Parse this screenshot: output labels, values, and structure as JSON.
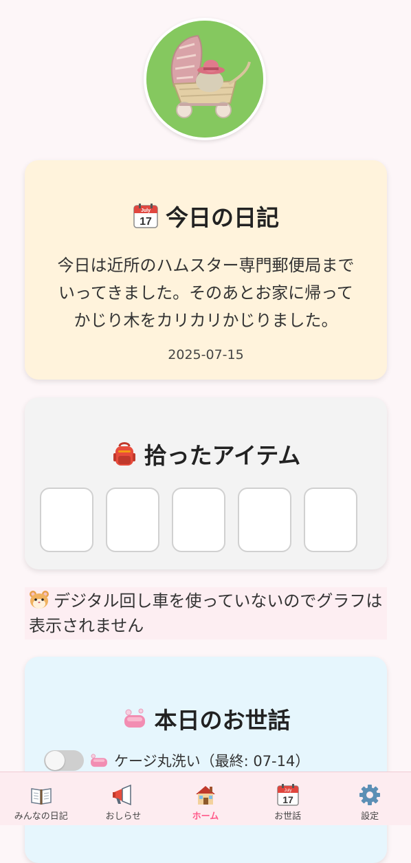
{
  "diary": {
    "title": "今日の日記",
    "icon": "calendar-icon",
    "calendar_month": "July",
    "calendar_day": "17",
    "line1": "今日は近所のハムスター専門郵便局まで",
    "line2": "いってきました。そのあとお家に帰って",
    "line3": "かじり木をカリカリかじりました。",
    "date": "2025-07-15"
  },
  "items": {
    "title": "拾ったアイテム",
    "icon": "backpack-icon",
    "slot_count": 5
  },
  "notice": {
    "icon": "hamster-icon",
    "text": "デジタル回し車を使っていないのでグラフは表示されません"
  },
  "care": {
    "title": "本日のお世話",
    "icon": "soap-icon",
    "tasks": [
      {
        "label": "ケージ丸洗い（最終: 07-14）",
        "enabled": false,
        "icon": "soap-icon"
      }
    ]
  },
  "nav": {
    "items": [
      {
        "label": "みんなの日記",
        "icon": "book-icon"
      },
      {
        "label": "おしらせ",
        "icon": "megaphone-icon"
      },
      {
        "label": "ホーム",
        "icon": "house-icon",
        "active": true
      },
      {
        "label": "お世話",
        "icon": "calendar-icon"
      },
      {
        "label": "設定",
        "icon": "gear-icon"
      }
    ],
    "calendar_day": "17",
    "calendar_month": "July"
  },
  "colors": {
    "background": "#fdf6f8",
    "diary_card": "#fff3dc",
    "items_card": "#f3f3f3",
    "care_card": "#e6f6fd",
    "notice_bg": "#fdeef2",
    "nav_active": "#ff5a8a"
  }
}
